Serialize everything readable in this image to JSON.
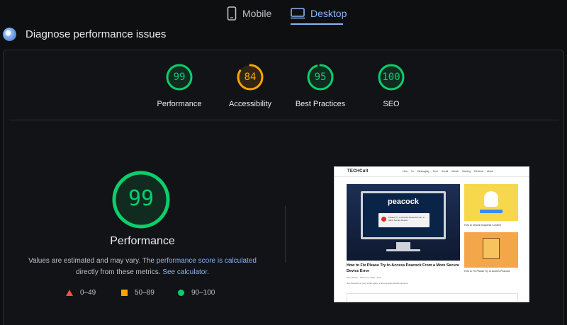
{
  "tabs": {
    "mobile": {
      "label": "Mobile",
      "icon": "phone-icon"
    },
    "desktop": {
      "label": "Desktop",
      "icon": "monitor-icon",
      "active": true
    }
  },
  "section_title": "Diagnose performance issues",
  "colors": {
    "pass": "#0cce6b",
    "average": "#ffa400",
    "fail": "#ff4e42",
    "link": "#8ab4f8"
  },
  "scores": [
    {
      "label": "Performance",
      "value": "99",
      "fraction": 0.99,
      "color": "#0cce6b"
    },
    {
      "label": "Accessibility",
      "value": "84",
      "fraction": 0.84,
      "color": "#ffa400"
    },
    {
      "label": "Best Practices",
      "value": "95",
      "fraction": 0.95,
      "color": "#0cce6b"
    },
    {
      "label": "SEO",
      "value": "100",
      "fraction": 1.0,
      "color": "#0cce6b"
    }
  ],
  "featured": {
    "value": "99",
    "fraction": 0.99,
    "title": "Performance",
    "note_before": "Values are estimated and may vary. The ",
    "note_link1": "performance score is calculated",
    "note_middle": " directly from these metrics. ",
    "note_link2": "See calculator."
  },
  "legend": [
    {
      "shape": "triangle",
      "range": "0–49"
    },
    {
      "shape": "square",
      "range": "50–89"
    },
    {
      "shape": "circle",
      "range": "90–100"
    }
  ],
  "thumbnail": {
    "logo": "TECHCult",
    "menu": "How To  Messaging  Tech  Social Media  Gaming  Reviews  About",
    "hero_brand": "peacock",
    "dialog_text": "Please Try to Access Peacock From a More Secure Device",
    "headline": "How to Fix Please Try to Access Peacock From a More Secure Device Error",
    "meta": "Elon Decker  ·  March 22, 2023  ·  Tech",
    "excerpt": "Get Peacock on your smart apps, a few premium streaming store",
    "side1_caption": "How to Unlock Snapchat Content",
    "side2_caption": "How to Fix Please Try to Access Peacock"
  }
}
